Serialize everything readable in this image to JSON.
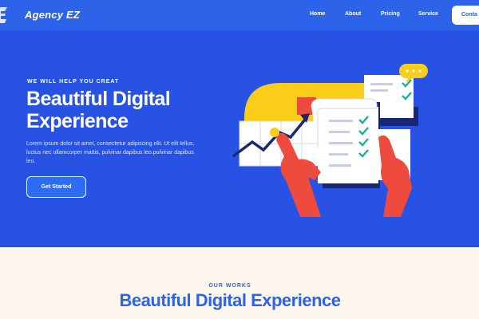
{
  "nav": {
    "logo_icon": "ez-logo-icon",
    "brand": "Agency EZ",
    "links": [
      "Home",
      "About",
      "Pricing",
      "Service"
    ],
    "cta_label": "Conta"
  },
  "hero": {
    "eyebrow": "WE WILL HELP YOU CREAT",
    "title_line1": "Beautiful Digital",
    "title_line2": "Experience",
    "description": "Lorem ipsum dolor sit amet, consectetur adipiscing elit. Ut elit tellus, luctus nec ullamcorper mattis, pulvinar dapibus leo.pulvinar dapibus leo.",
    "cta_label": "Get Started",
    "illustration_icon": "digital-experience-illustration-icon"
  },
  "works": {
    "eyebrow": "OUR WORKS",
    "title": "Beautiful Digital Experience"
  },
  "colors": {
    "nav_bg": "#2d63e8",
    "hero_bg": "#2852e3",
    "section_bg": "#fdf6ec",
    "accent_yellow": "#f9cd18",
    "accent_red": "#ee4a3d"
  }
}
